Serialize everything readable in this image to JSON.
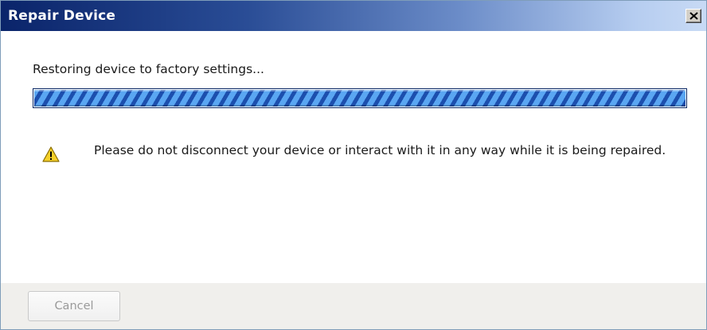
{
  "window": {
    "title": "Repair Device",
    "close_icon": "close-icon"
  },
  "progress": {
    "status_text": "Restoring device to factory settings...",
    "fraction": 1.0,
    "style": "indeterminate-striped",
    "colors": {
      "stripe_dark": "#1c4fae",
      "stripe_light": "#5aa6f2",
      "border": "#0c2a66"
    }
  },
  "warning": {
    "icon": "warning-icon",
    "text": "Please do not disconnect your device or interact with it in any way while it is being repaired."
  },
  "footer": {
    "cancel_label": "Cancel",
    "cancel_enabled": false
  },
  "colors": {
    "title_gradient_start": "#0a246a",
    "title_gradient_end": "#c8daf5",
    "warning_yellow": "#f5d02a"
  }
}
